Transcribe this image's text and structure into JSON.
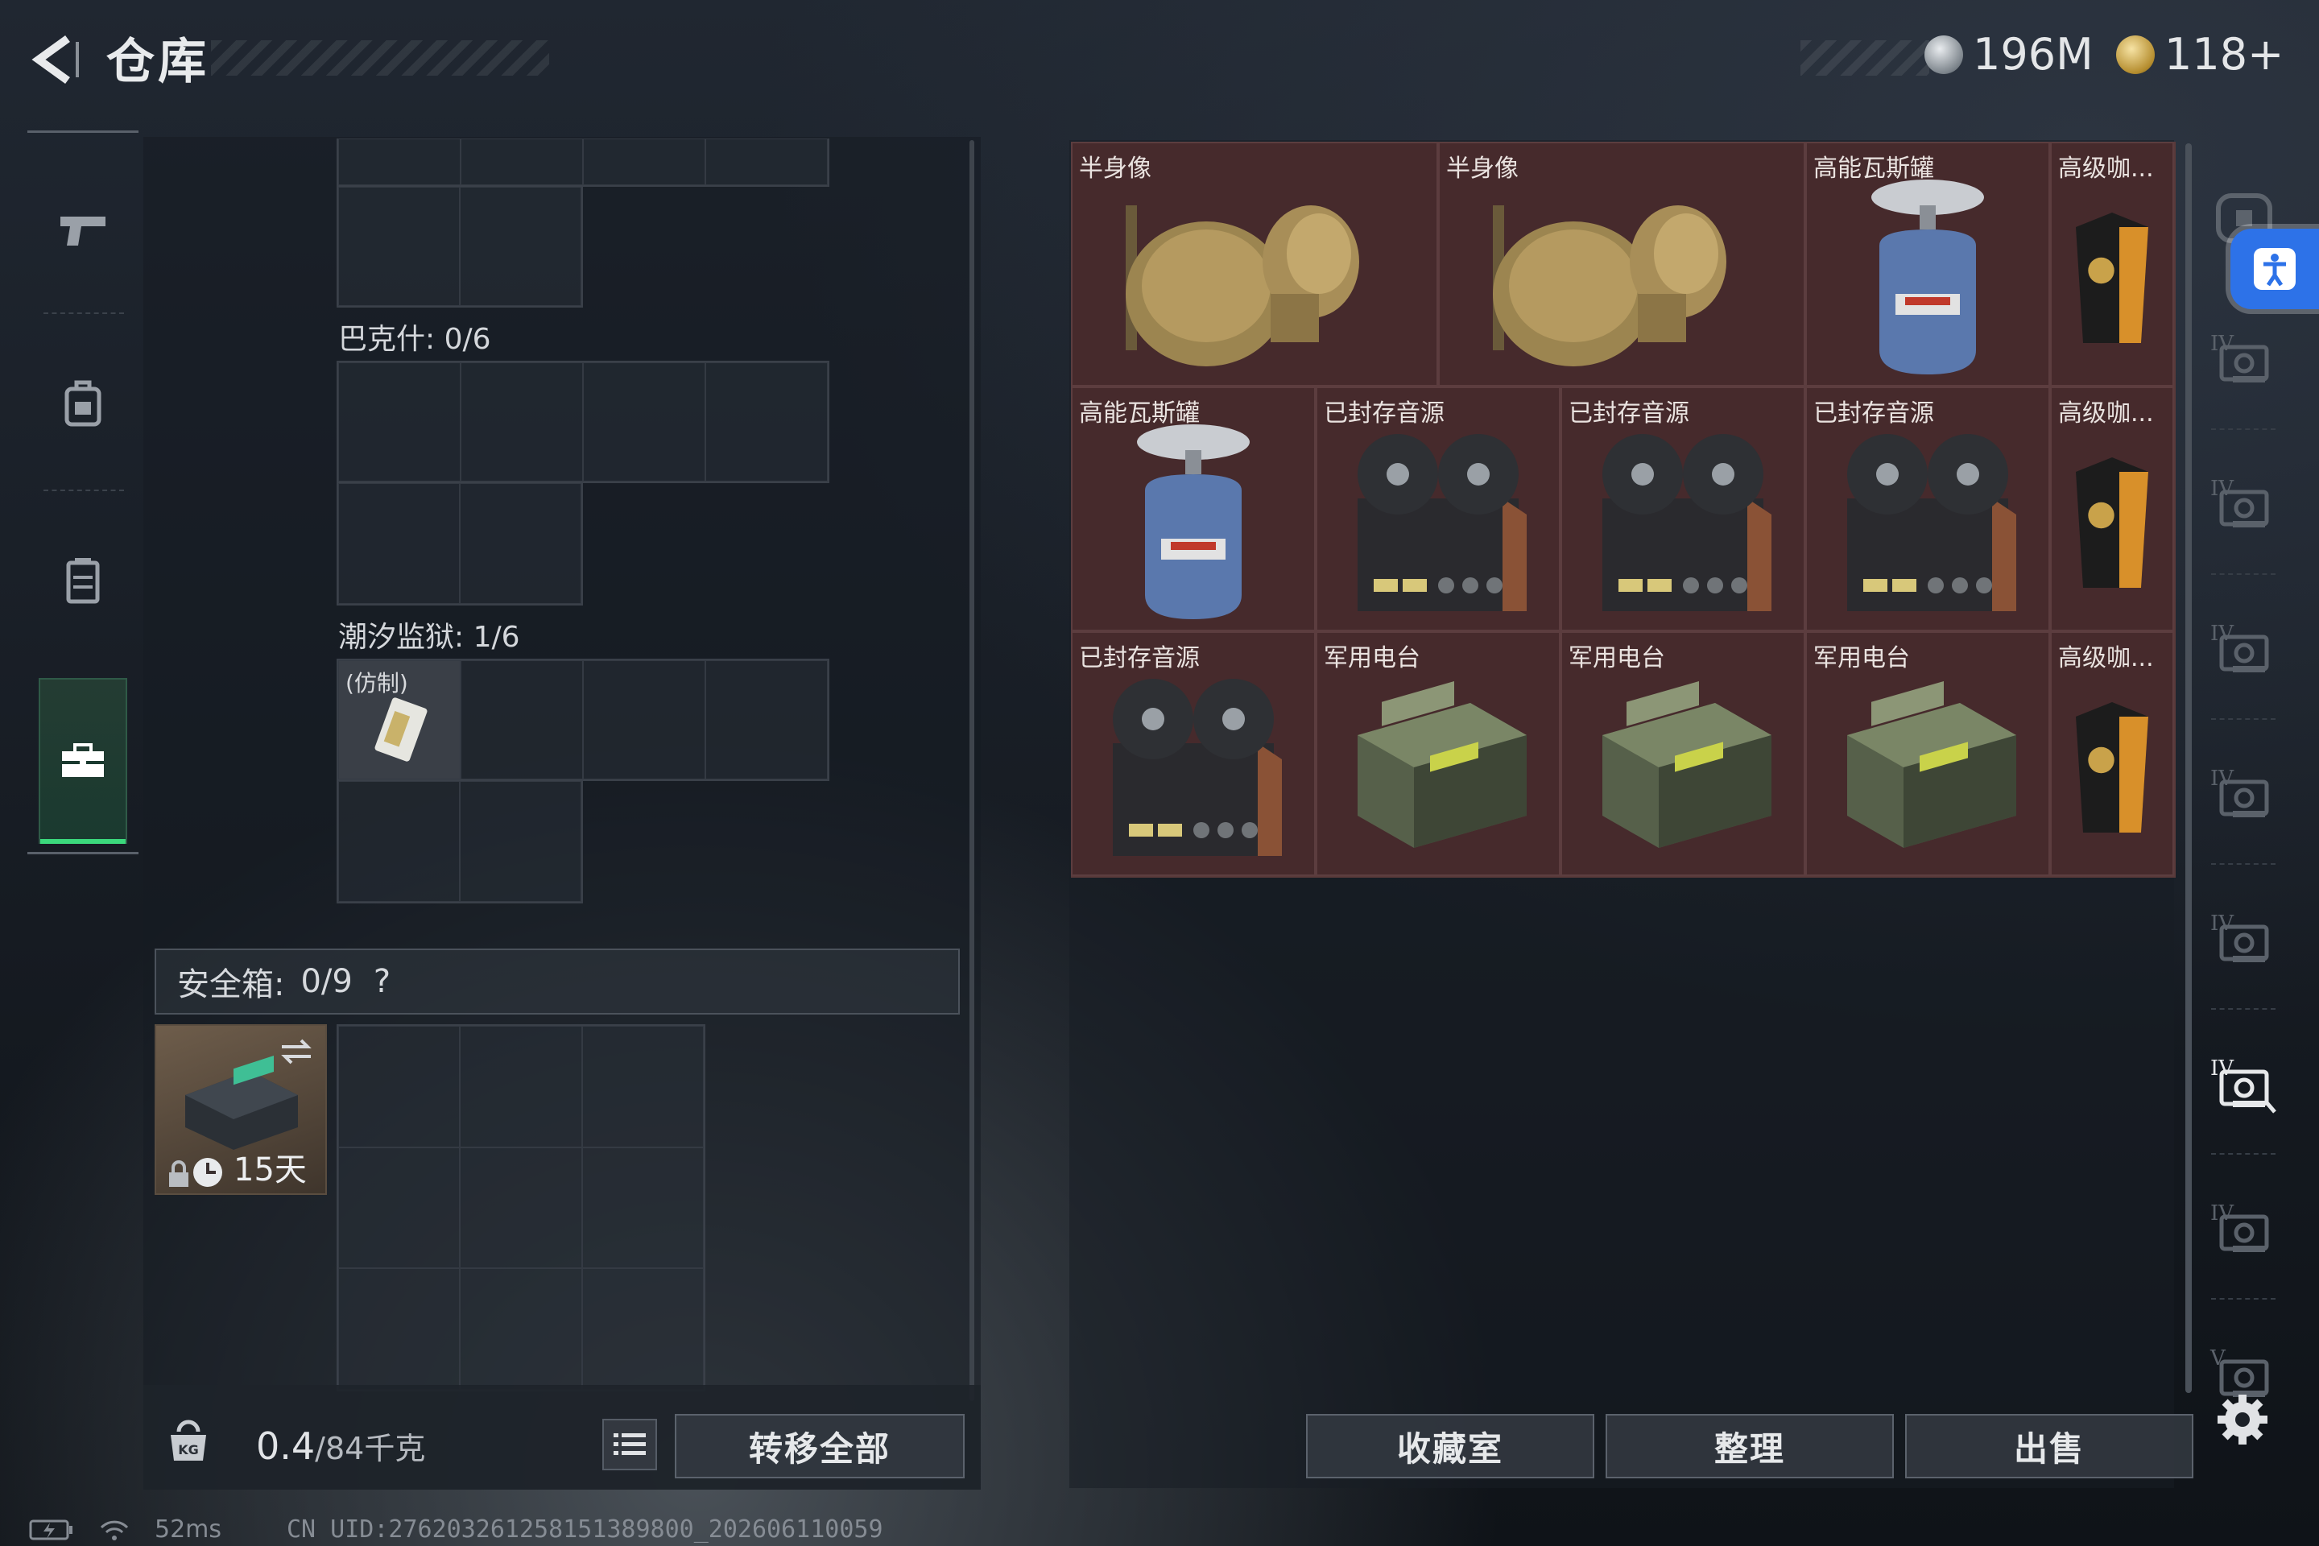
{
  "header": {
    "title": "仓库",
    "currency1": "196M",
    "currency2": "118+"
  },
  "left_nav": [
    "weapon",
    "backpack",
    "vest",
    "storage-case"
  ],
  "sections": {
    "bakshi_label": "巴克什: 0/6",
    "tidal_label": "潮汐监狱: 1/6",
    "tidal_item_label": "(仿制)"
  },
  "safe_box": {
    "title": "安全箱:",
    "count": "0/9",
    "help": "?",
    "duration": "15天"
  },
  "bottom_left": {
    "weight_value": "0.4",
    "weight_total": "/84千克",
    "transfer_all": "转移全部"
  },
  "inventory": [
    {
      "label": "半身像",
      "icon": "bust-icon"
    },
    {
      "label": "半身像",
      "icon": "bust-icon"
    },
    {
      "label": "高能瓦斯罐",
      "icon": "gas-canister-icon"
    },
    {
      "label": "高级咖...",
      "icon": "coffee-bag-icon"
    },
    {
      "label": "高能瓦斯罐",
      "icon": "gas-canister-icon"
    },
    {
      "label": "已封存音源",
      "icon": "tape-recorder-icon"
    },
    {
      "label": "已封存音源",
      "icon": "tape-recorder-icon"
    },
    {
      "label": "已封存音源",
      "icon": "tape-recorder-icon"
    },
    {
      "label": "高级咖...",
      "icon": "coffee-bag-icon"
    },
    {
      "label": "已封存音源",
      "icon": "tape-recorder-icon"
    },
    {
      "label": "军用电台",
      "icon": "military-radio-icon"
    },
    {
      "label": "军用电台",
      "icon": "military-radio-icon"
    },
    {
      "label": "军用电台",
      "icon": "military-radio-icon"
    },
    {
      "label": "高级咖...",
      "icon": "coffee-bag-icon"
    }
  ],
  "side_tabs": [
    "IV",
    "IV",
    "IV",
    "IV",
    "IV",
    "IV",
    "IV",
    "V"
  ],
  "bottom_right": {
    "collection": "收藏室",
    "sort": "整理",
    "sell": "出售"
  },
  "status": {
    "ping": "52ms",
    "uid": "CN UID:276203261258151389800_202606110059"
  }
}
